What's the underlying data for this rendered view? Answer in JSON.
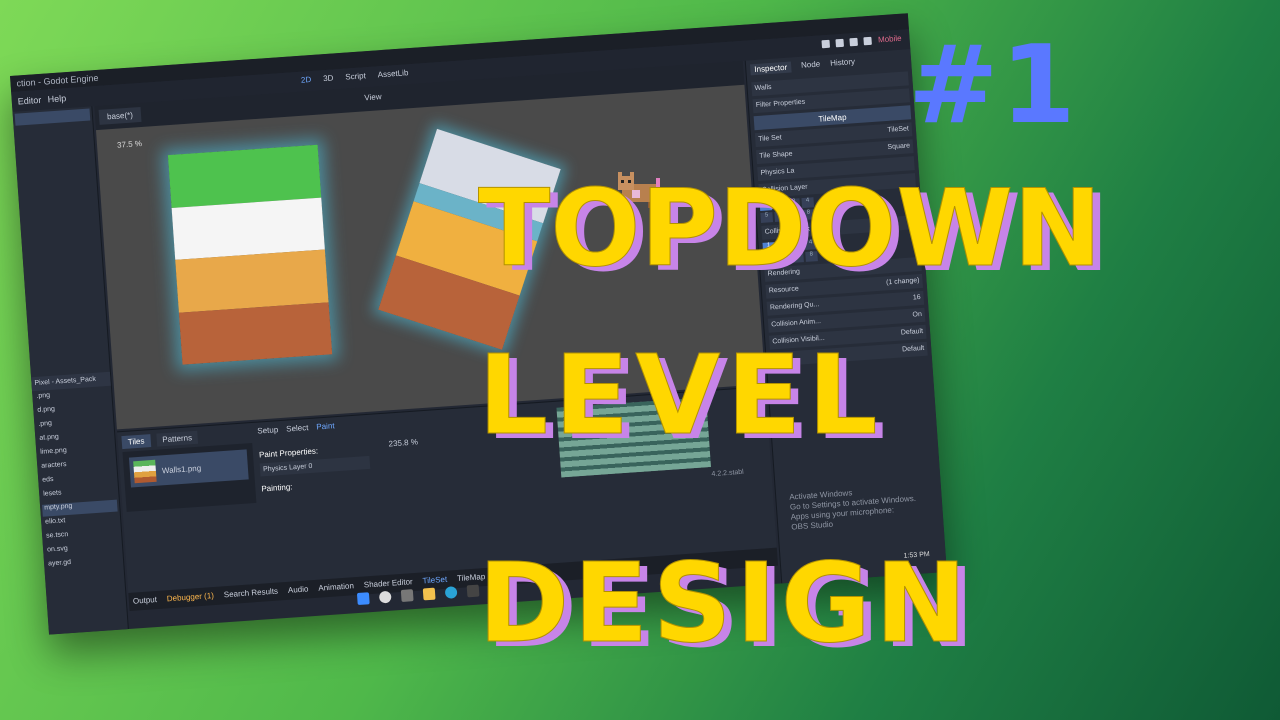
{
  "editor": {
    "title": "ction - Godot Engine",
    "menu": [
      "Editor",
      "Help"
    ],
    "workspaces": [
      "2D",
      "3D",
      "Script",
      "AssetLib"
    ],
    "active_workspace": "2D",
    "renderer": "Mobile",
    "scene_tab": "base(*)",
    "view_label": "View",
    "zoom": "37.5 %",
    "filesystem_path": "Pixel - Assets_Pack",
    "files": [
      ".png",
      "d.png",
      ".png",
      "at.png",
      "lime.png",
      "aracters",
      "eds",
      "lesets",
      "mpty.png",
      "ello.txt",
      "se.tscn",
      "on.svg",
      "ayer.gd"
    ],
    "selected_file": "mpty.png",
    "inspector": {
      "tabs": [
        "Inspector",
        "Node",
        "History"
      ],
      "active_tab": "Inspector",
      "node_name": "Walls",
      "filter": "Filter Properties",
      "section": "TileMap",
      "tile_set_label": "Tile Set",
      "tile_set_value": "TileSet",
      "tile_shape_label": "Tile Shape",
      "tile_shape_value": "Square",
      "physics_label": "Physics La",
      "collision_layer": "Collision Layer",
      "collision_mask": "Collision Mask",
      "layer_bits": [
        "1",
        "2",
        "3",
        "4",
        "5",
        "6",
        "7",
        "8"
      ],
      "collapsed": [
        "Rendering",
        "Resource"
      ],
      "changes": "(1 change)",
      "rendering_quadrant": "Rendering Qu...",
      "rendering_quadrant_value": "16",
      "collision_animatable": "Collision Anim...",
      "collision_animatable_value": "On",
      "collision_visibility": "Collision Visibil...",
      "collision_visibility_value": "Default",
      "navigation_visibility_value": "Default"
    },
    "bottom": {
      "tabs": [
        "Tiles",
        "Patterns"
      ],
      "active_tab": "Tiles",
      "tile_item": "Walls1.png",
      "modes": [
        "Setup",
        "Select",
        "Paint"
      ],
      "active_mode": "Paint",
      "paint_properties": "Paint Properties:",
      "physics_layer": "Physics Layer 0",
      "painting": "Painting:",
      "zoom": "235.8 %",
      "version": "4.2.2.stabl"
    },
    "dock_tabs": [
      "Output",
      "Debugger (1)",
      "Search Results",
      "Audio",
      "Animation",
      "Shader Editor",
      "TileSet",
      "TileMap"
    ],
    "activate_windows": [
      "Activate Windows",
      "Go to Settings to activate Windows.",
      "Apps using your microphone:",
      "OBS Studio"
    ],
    "clock": "1:53 PM"
  },
  "overlay": {
    "episode": "#1",
    "line1": "TOPDOWN",
    "line2": "LEVEL",
    "line3": "DESIGN"
  },
  "colors": {
    "title_yellow": "#ffd700",
    "title_shadow": "#c784e8",
    "episode_blue": "#5a78ff",
    "accent": "#6fa8ff"
  }
}
